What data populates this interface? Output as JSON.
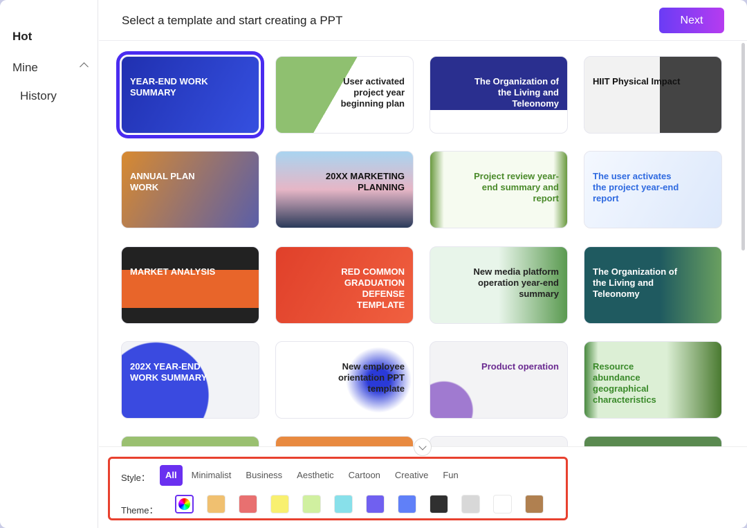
{
  "sidebar": {
    "hot": "Hot",
    "mine": "Mine",
    "history": "History"
  },
  "header": {
    "title": "Select a template and start creating a PPT",
    "next": "Next"
  },
  "templates": [
    {
      "title": "YEAR-END WORK SUMMARY",
      "bg": "linear-gradient(120deg,#2030b0,#3550e0)",
      "fg": "#fff"
    },
    {
      "title": "User activated project year beginning plan",
      "bg": "linear-gradient(120deg,#8fc070 0 45%,#fff 45%)",
      "fg": "#222"
    },
    {
      "title": "The Organization of the Living and Teleonomy",
      "bg": "linear-gradient(180deg,#2a2f8f 0 70%,#fff 70%)",
      "fg": "#fff"
    },
    {
      "title": "HIIT Physical Impact",
      "bg": "linear-gradient(90deg,#f2f2f2 55%,#444 55%)",
      "fg": "#111"
    },
    {
      "title": "ANNUAL PLAN WORK",
      "bg": "linear-gradient(120deg,#d88a30,#5a5ea8)",
      "fg": "#fff"
    },
    {
      "title": "20XX MARKETING PLANNING",
      "bg": "linear-gradient(180deg,#a9d4f0,#e6b6c6 50%,#2a3a5a)",
      "fg": "#111"
    },
    {
      "title": "Project review year-end summary and report",
      "bg": "linear-gradient(90deg,#6a9a40,#f6fbf0 10% 90%,#6a9a40)",
      "fg": "#4a8a2a"
    },
    {
      "title": "The user activates the project year-end report",
      "bg": "linear-gradient(120deg,#f4f8ff,#dce8fb)",
      "fg": "#2f6ae0"
    },
    {
      "title": "MARKET ANALYSIS",
      "bg": "linear-gradient(180deg,#222 0 30%,#e8652a 30% 80%,#222 80%)",
      "fg": "#fff"
    },
    {
      "title": "RED COMMON GRADUATION DEFENSE TEMPLATE",
      "bg": "linear-gradient(120deg,#e0402a,#f06040)",
      "fg": "#fff"
    },
    {
      "title": "New media platform operation year-end summary",
      "bg": "linear-gradient(90deg,#e8f5ea 50%,#5a9a50)",
      "fg": "#222"
    },
    {
      "title": "The Organization of the Living and Teleonomy",
      "bg": "linear-gradient(90deg,#1f5a60 55%,#6aa060)",
      "fg": "#fff"
    },
    {
      "title": "202X YEAR-END WORK SUMMARY",
      "bg": "radial-gradient(circle at 25% 70%,#3a4ae0 45%,#f2f3f7 46%)",
      "fg": "#fff"
    },
    {
      "title": "New employee orientation PPT template",
      "bg": "radial-gradient(circle at 75% 50%,#2a3ad8 10%,#fff 30%)",
      "fg": "#222"
    },
    {
      "title": "Product operation",
      "bg": "radial-gradient(circle at 10% 90%,#a07ad0 20%,#f3f3f5 21%)",
      "fg": "#6a2a90"
    },
    {
      "title": "Resource abundance geographical characteristics",
      "bg": "linear-gradient(90deg,#4a8a40,#dcefd5 10% 60%,#4a7a30)",
      "fg": "#3a8a2a"
    }
  ],
  "partial_row": [
    "#9ac070",
    "#e88a40",
    "#f4f4f6",
    "#5a8a50"
  ],
  "filter": {
    "style_label": "Style：",
    "theme_label": "Theme：",
    "styles": [
      "All",
      "Minimalist",
      "Business",
      "Aesthetic",
      "Cartoon",
      "Creative",
      "Fun"
    ],
    "selected_style": "All",
    "themes": [
      "multicolor",
      "#f0c070",
      "#e87070",
      "#f8f070",
      "#d0f0a0",
      "#88e0ea",
      "#7060f0",
      "#6080f8",
      "#303030",
      "#d8d8d8",
      "#ffffff",
      "#b08050"
    ]
  }
}
